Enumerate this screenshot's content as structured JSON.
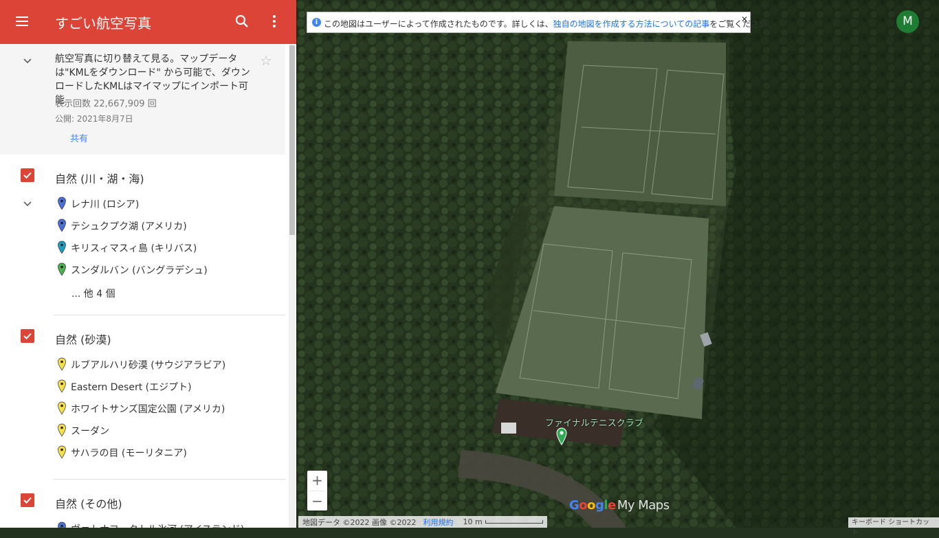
{
  "app": {
    "title": "すごい航空写真",
    "accent_color": "#db4437"
  },
  "description": {
    "text": "航空写真に切り替えて見る。マップデータは\"KMLをダウンロード\" から可能で、ダウンロードしたKMLはマイマップにインポート可能",
    "views": "表示回数 22,667,909 回",
    "published": "公開: 2021年8月7日",
    "share_label": "共有"
  },
  "layers": [
    {
      "name": "自然 (川・湖・海)",
      "checked": true,
      "items": [
        {
          "label": "レナ川 (ロシア)",
          "pin_color": "#4a6fd8"
        },
        {
          "label": "テシュクプク湖 (アメリカ)",
          "pin_color": "#4a6fd8"
        },
        {
          "label": "キリスィマスィ島 (キリバス)",
          "pin_color": "#1e9fc2"
        },
        {
          "label": "スンダルバン (バングラデシュ)",
          "pin_color": "#4caf50"
        }
      ],
      "more": "... 他 4 個"
    },
    {
      "name": "自然 (砂漠)",
      "checked": true,
      "items": [
        {
          "label": "ルブアルハリ砂漠 (サウジアラビア)",
          "pin_color": "#f4e04d"
        },
        {
          "label": "Eastern Desert (エジプト)",
          "pin_color": "#f4e04d"
        },
        {
          "label": "ホワイトサンズ国定公園 (アメリカ)",
          "pin_color": "#f4e04d"
        },
        {
          "label": "スーダン",
          "pin_color": "#f4e04d"
        },
        {
          "label": "サハラの目 (モーリタニア)",
          "pin_color": "#f4e04d"
        }
      ]
    },
    {
      "name": "自然 (その他)",
      "checked": true,
      "items": [
        {
          "label": "ヴァトナヨークトル氷河 (アイスランド)",
          "pin_color": "#4a6fd8"
        }
      ]
    }
  ],
  "map": {
    "banner_text": "この地図はユーザーによって作成されたものです。詳しくは、",
    "banner_link": "独自の地図を作成する方法についての記事",
    "banner_suffix": "をご覧ください。",
    "avatar_letter": "M",
    "place_label": "ファイナルテニスクラブ",
    "zoom_in": "+",
    "zoom_out": "−",
    "footer_copyright": "地図データ ©2022 画像 ©2022",
    "footer_terms": "利用規約",
    "footer_scale": "10 m",
    "keyboard_shortcuts": "キーボード ショートカット",
    "logo_text": "Google",
    "logo_suffix": "My Maps"
  }
}
